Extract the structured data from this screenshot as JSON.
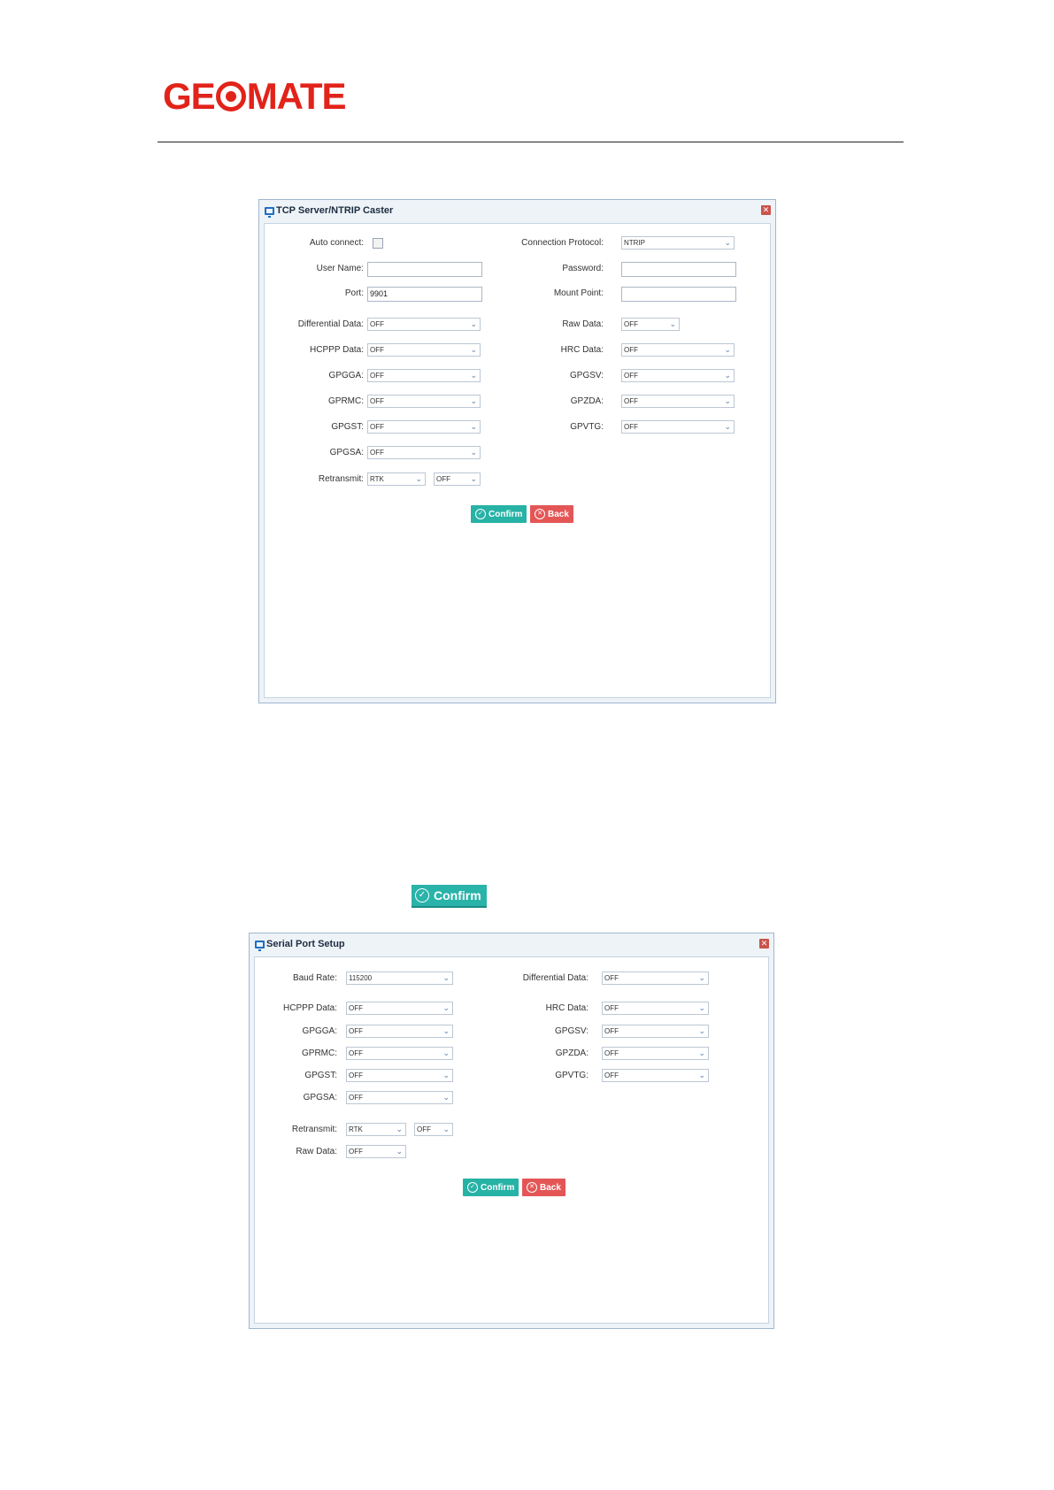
{
  "logo": {
    "pre": "GE",
    "post": "MATE"
  },
  "tcp": {
    "title": "TCP Server/NTRIP Caster",
    "auto_connect_label": "Auto connect:",
    "connection_protocol_label": "Connection Protocol:",
    "connection_protocol_value": "NTRIP",
    "user_name_label": "User Name:",
    "user_name_value": "",
    "password_label": "Password:",
    "password_value": "",
    "port_label": "Port:",
    "port_value": "9901",
    "mount_point_label": "Mount Point:",
    "mount_point_value": "",
    "differential_label": "Differential Data:",
    "differential_value": "OFF",
    "raw_label": "Raw Data:",
    "raw_value": "OFF",
    "hcppp_label": "HCPPP Data:",
    "hcppp_value": "OFF",
    "hrc_label": "HRC Data:",
    "hrc_value": "OFF",
    "gpgga_label": "GPGGA:",
    "gpgga_value": "OFF",
    "gpgsv_label": "GPGSV:",
    "gpgsv_value": "OFF",
    "gprmc_label": "GPRMC:",
    "gprmc_value": "OFF",
    "gpzda_label": "GPZDA:",
    "gpzda_value": "OFF",
    "gpgst_label": "GPGST:",
    "gpgst_value": "OFF",
    "gpvtg_label": "GPVTG:",
    "gpvtg_value": "OFF",
    "gpgsa_label": "GPGSA:",
    "gpgsa_value": "OFF",
    "retransmit_label": "Retransmit:",
    "retransmit_value1": "RTK",
    "retransmit_value2": "OFF",
    "confirm": "Confirm",
    "back": "Back"
  },
  "standalone_confirm": "Confirm",
  "serial": {
    "title": "Serial Port Setup",
    "baud_label": "Baud Rate:",
    "baud_value": "115200",
    "differential_label": "Differential Data:",
    "differential_value": "OFF",
    "hcppp_label": "HCPPP Data:",
    "hcppp_value": "OFF",
    "hrc_label": "HRC Data:",
    "hrc_value": "OFF",
    "gpgga_label": "GPGGA:",
    "gpgga_value": "OFF",
    "gpgsv_label": "GPGSV:",
    "gpgsv_value": "OFF",
    "gprmc_label": "GPRMC:",
    "gprmc_value": "OFF",
    "gpzda_label": "GPZDA:",
    "gpzda_value": "OFF",
    "gpgst_label": "GPGST:",
    "gpgst_value": "OFF",
    "gpvtg_label": "GPVTG:",
    "gpvtg_value": "OFF",
    "gpgsa_label": "GPGSA:",
    "gpgsa_value": "OFF",
    "retransmit_label": "Retransmit:",
    "retransmit_value1": "RTK",
    "retransmit_value2": "OFF",
    "raw_label": "Raw Data:",
    "raw_value": "OFF",
    "confirm": "Confirm",
    "back": "Back"
  }
}
